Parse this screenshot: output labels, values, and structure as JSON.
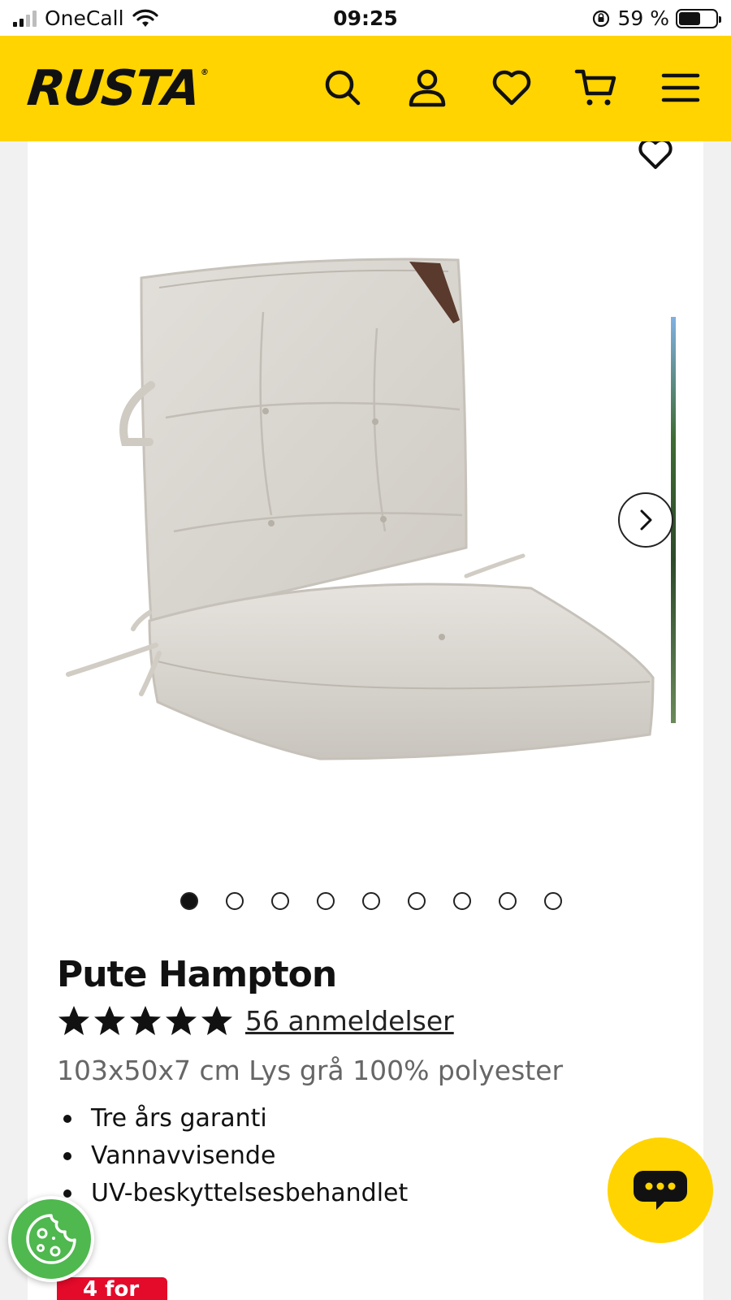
{
  "status_bar": {
    "carrier": "OneCall",
    "time": "09:25",
    "battery": "59 %"
  },
  "header": {
    "logo": "RUSTA",
    "logo_mark": "®",
    "icons": [
      "search-icon",
      "account-icon",
      "heart-icon",
      "cart-icon",
      "menu-icon"
    ]
  },
  "gallery": {
    "slide_count": 9,
    "active_index": 0
  },
  "product": {
    "title": "Pute Hampton",
    "rating_stars": 5,
    "reviews": "56 anmeldelser",
    "description": "103x50x7 cm Lys grå 100% polyester",
    "features": [
      "Tre års garanti",
      "Vannavvisende",
      "UV-beskyttelsesbehandlet"
    ],
    "promo_badge": "4 for"
  },
  "colors": {
    "brand_yellow": "#ffd400",
    "promo_red": "#e30a2a",
    "cookie_green": "#4fb84f"
  }
}
